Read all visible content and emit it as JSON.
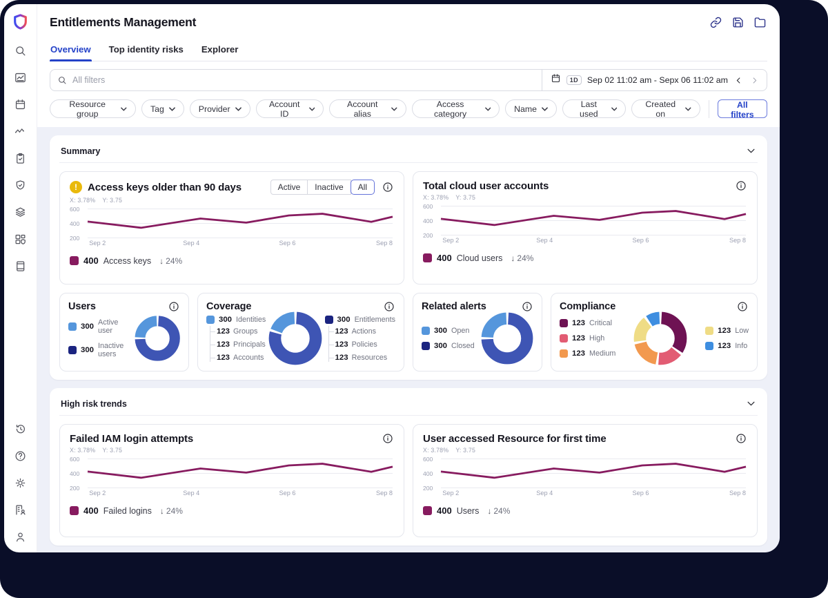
{
  "app": {
    "title": "Entitlements Management",
    "window_icons": [
      "link-icon",
      "save-icon",
      "folder-icon"
    ],
    "colors": {
      "accent_blue": "#2442C8",
      "navy_icon": "#252C86",
      "line_maroon": "#871B5F",
      "bg_dark": "#0A0E28",
      "content_bg": "#EEF0F8"
    }
  },
  "sidebar": {
    "top_icons": [
      "logo-shield",
      "search",
      "analytics-chart",
      "calendar",
      "activity-trend",
      "audit-clipboard",
      "policy-shield",
      "layers",
      "inventory",
      "documentation"
    ],
    "bottom_icons": [
      "history",
      "help",
      "settings",
      "directory",
      "profile"
    ]
  },
  "tabs": [
    {
      "label": "Overview",
      "active": true
    },
    {
      "label": "Top identity risks",
      "active": false
    },
    {
      "label": "Explorer",
      "active": false
    }
  ],
  "filter_bar": {
    "search_placeholder": "All filters",
    "date": {
      "preset": "1D",
      "range": "Sep 02 11:02 am - Sepx 06 11:02 am"
    }
  },
  "filter_chips": [
    "Resource group",
    "Tag",
    "Provider",
    "Account ID",
    "Account alias",
    "Access category",
    "Name",
    "Last used",
    "Created on"
  ],
  "all_filters_label": "All filters",
  "sections": {
    "summary": {
      "title": "Summary"
    },
    "high_risk": {
      "title": "High risk trends"
    }
  },
  "cards": {
    "access_keys": {
      "title": "Access keys older than 90 days",
      "toggle": [
        "Active",
        "Inactive",
        "All"
      ],
      "toggle_selected": "All",
      "coord_x": "X: 3.78%",
      "coord_y": "Y: 3.75",
      "legend": {
        "value": "400",
        "label": "Access keys",
        "delta": "24%",
        "direction": "down"
      }
    },
    "cloud_accounts": {
      "title": "Total cloud user accounts",
      "coord_x": "X: 3.78%",
      "coord_y": "Y: 3.75",
      "legend": {
        "value": "400",
        "label": "Cloud users",
        "delta": "24%",
        "direction": "down"
      }
    },
    "users": {
      "title": "Users",
      "legend": [
        {
          "value": "300",
          "label": "Active user",
          "color": "#5596DC"
        },
        {
          "value": "300",
          "label": "Inactive users",
          "color": "#1B2480"
        }
      ]
    },
    "coverage": {
      "title": "Coverage",
      "left": {
        "value": "300",
        "label": "Identities",
        "color": "#5596DC",
        "children": [
          {
            "value": "123",
            "label": "Groups"
          },
          {
            "value": "123",
            "label": "Principals"
          },
          {
            "value": "123",
            "label": "Accounts"
          }
        ]
      },
      "right": {
        "value": "300",
        "label": "Entitlements",
        "color": "#1B2480",
        "children": [
          {
            "value": "123",
            "label": "Actions"
          },
          {
            "value": "123",
            "label": "Policies"
          },
          {
            "value": "123",
            "label": "Resources"
          }
        ]
      }
    },
    "related_alerts": {
      "title": "Related alerts",
      "legend": [
        {
          "value": "300",
          "label": "Open",
          "color": "#5596DC"
        },
        {
          "value": "300",
          "label": "Closed",
          "color": "#1B2480"
        }
      ]
    },
    "compliance": {
      "title": "Compliance",
      "legend_left": [
        {
          "value": "123",
          "label": "Critical",
          "color": "#6E1253"
        },
        {
          "value": "123",
          "label": "High",
          "color": "#E25C73"
        },
        {
          "value": "123",
          "label": "Medium",
          "color": "#F2994F"
        }
      ],
      "legend_right": [
        {
          "value": "123",
          "label": "Low",
          "color": "#EFDC85"
        },
        {
          "value": "123",
          "label": "Info",
          "color": "#3E8EE0"
        }
      ]
    },
    "failed_logins": {
      "title": "Failed IAM login attempts",
      "coord_x": "X: 3.78%",
      "coord_y": "Y: 3.75",
      "legend": {
        "value": "400",
        "label": "Failed logins",
        "delta": "24%",
        "direction": "down"
      }
    },
    "first_access": {
      "title": "User accessed Resource for first time",
      "coord_x": "X: 3.78%",
      "coord_y": "Y: 3.75",
      "legend": {
        "value": "400",
        "label": "Users",
        "delta": "24%",
        "direction": "down"
      }
    }
  },
  "chart_data": {
    "trend_line": {
      "type": "line",
      "color": "#871B5F",
      "ylim": [
        200,
        600
      ],
      "y_ticks": [
        600,
        400,
        200
      ],
      "x": [
        0,
        0.175,
        0.37,
        0.52,
        0.66,
        0.77,
        0.93,
        1
      ],
      "values": [
        420,
        335,
        462,
        406,
        505,
        528,
        417,
        487
      ],
      "x_ticks": [
        {
          "label": "Sep 2",
          "pos": 0.005
        },
        {
          "label": "Sep 4",
          "pos": 0.34
        },
        {
          "label": "Sep 6",
          "pos": 0.655
        },
        {
          "label": "Sep 8",
          "pos": 1
        }
      ],
      "used_by": [
        "Access keys older than 90 days",
        "Total cloud user accounts",
        "Failed IAM login attempts",
        "User accessed Resource for first time"
      ]
    },
    "users_donut": {
      "type": "pie",
      "segments": [
        {
          "label": "Inactive users",
          "value": 300,
          "pct": 75,
          "color": "#3E55B4"
        },
        {
          "label": "Active user",
          "value": 300,
          "pct": 25,
          "color": "#5596DC"
        }
      ]
    },
    "coverage_donut": {
      "type": "pie",
      "segments": [
        {
          "label": "Entitlements",
          "value": 300,
          "pct": 80,
          "color": "#3E55B4"
        },
        {
          "label": "Identities",
          "value": 300,
          "pct": 20,
          "color": "#5596DC"
        }
      ]
    },
    "alerts_donut": {
      "type": "pie",
      "segments": [
        {
          "label": "Closed",
          "value": 300,
          "pct": 75,
          "color": "#3E55B4"
        },
        {
          "label": "Open",
          "value": 300,
          "pct": 25,
          "color": "#5596DC"
        }
      ]
    },
    "compliance_donut": {
      "type": "pie",
      "segments": [
        {
          "label": "Critical",
          "value": 123,
          "pct": 35,
          "color": "#6E1253"
        },
        {
          "label": "High",
          "value": 123,
          "pct": 17,
          "color": "#E25C73"
        },
        {
          "label": "Medium",
          "value": 123,
          "pct": 20,
          "color": "#F2994F"
        },
        {
          "label": "Low",
          "value": 123,
          "pct": 18,
          "color": "#EFDC85"
        },
        {
          "label": "Info",
          "value": 123,
          "pct": 10,
          "color": "#3E8EE0"
        }
      ]
    }
  }
}
